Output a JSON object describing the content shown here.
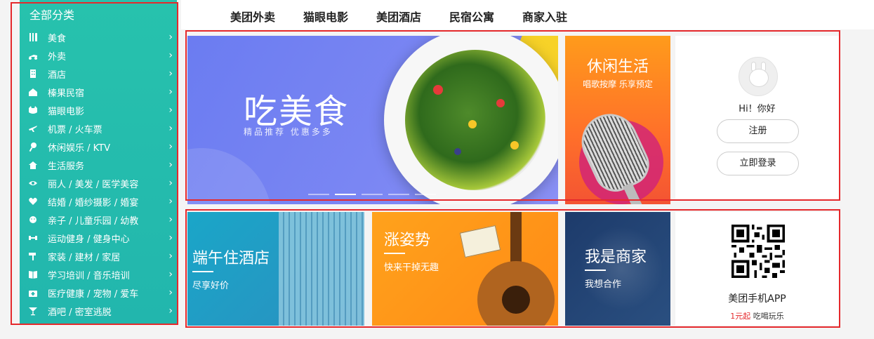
{
  "topnav": {
    "items": [
      "美团外卖",
      "猫眼电影",
      "美团酒店",
      "民宿公寓",
      "商家入驻"
    ]
  },
  "sidebar": {
    "title": "全部分类",
    "items": [
      {
        "label": "美食",
        "icon": "cutlery-icon"
      },
      {
        "label": "外卖",
        "icon": "scooter-icon"
      },
      {
        "label": "酒店",
        "icon": "building-icon"
      },
      {
        "label": "榛果民宿",
        "icon": "house-icon"
      },
      {
        "label": "猫眼电影",
        "icon": "cat-icon"
      },
      {
        "label": "机票 / 火车票",
        "icon": "plane-icon"
      },
      {
        "label": "休闲娱乐 / KTV",
        "icon": "microphone-icon"
      },
      {
        "label": "生活服务",
        "icon": "home-service-icon"
      },
      {
        "label": "丽人 / 美发 / 医学美容",
        "icon": "eye-icon"
      },
      {
        "label": "结婚 / 婚纱摄影 / 婚宴",
        "icon": "heart-icon"
      },
      {
        "label": "亲子 / 儿童乐园 / 幼教",
        "icon": "baby-icon"
      },
      {
        "label": "运动健身 / 健身中心",
        "icon": "dumbbell-icon"
      },
      {
        "label": "家装 / 建材 / 家居",
        "icon": "paint-roller-icon"
      },
      {
        "label": "学习培训 / 音乐培训",
        "icon": "book-icon"
      },
      {
        "label": "医疗健康 / 宠物 / 爱车",
        "icon": "medical-kit-icon"
      },
      {
        "label": "酒吧 / 密室逃脱",
        "icon": "cocktail-icon"
      }
    ],
    "chevron": "›"
  },
  "banner_main": {
    "title": "吃美食",
    "subtitle": "精品推荐  优惠多多",
    "indicator_count": 5,
    "active_indicator": 1
  },
  "banner_leisure": {
    "title": "休闲生活",
    "subtitle": "唱歌按摩 乐享预定"
  },
  "user_card": {
    "greeting": "Hi！你好",
    "register_label": "注册",
    "login_label": "立即登录"
  },
  "tiles": {
    "hotel": {
      "title": "端午住酒店",
      "subtitle": "尽享好价"
    },
    "pose": {
      "title": "涨姿势",
      "subtitle": "快来干掉无趣"
    },
    "merchant": {
      "title": "我是商家",
      "subtitle": "我想合作"
    },
    "app": {
      "title": "美团手机APP",
      "sub_red": "1元起",
      "sub_rest": "吃喝玩乐"
    }
  },
  "colors": {
    "sidebar": "#22b6ad",
    "outline": "#e5292c",
    "banner_main": "#6b7cf1",
    "leisure": "#ff7a25"
  }
}
